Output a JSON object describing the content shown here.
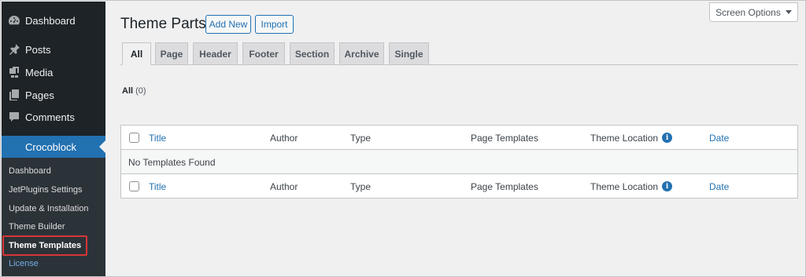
{
  "sidebar": {
    "menu": [
      {
        "label": "Dashboard",
        "icon": "dashboard-icon"
      },
      {
        "label": "Posts",
        "icon": "pin-icon"
      },
      {
        "label": "Media",
        "icon": "media-icon"
      },
      {
        "label": "Pages",
        "icon": "pages-icon"
      },
      {
        "label": "Comments",
        "icon": "comment-icon"
      },
      {
        "label": "Crocoblock",
        "icon": "crocoblock-icon"
      }
    ],
    "submenu": [
      {
        "label": "Dashboard"
      },
      {
        "label": "JetPlugins Settings"
      },
      {
        "label": "Update & Installation"
      },
      {
        "label": "Theme Builder"
      },
      {
        "label": "Theme Templates"
      },
      {
        "label": "License"
      }
    ]
  },
  "header": {
    "title": "Theme Parts",
    "add_new": "Add New",
    "import": "Import",
    "screen_options": "Screen Options"
  },
  "tabs": [
    {
      "label": "All",
      "active": true
    },
    {
      "label": "Page"
    },
    {
      "label": "Header"
    },
    {
      "label": "Footer"
    },
    {
      "label": "Section"
    },
    {
      "label": "Archive"
    },
    {
      "label": "Single"
    }
  ],
  "filter": {
    "label": "All",
    "count": "(0)"
  },
  "table": {
    "columns": [
      "Title",
      "Author",
      "Type",
      "Page Templates",
      "Theme Location",
      "Date"
    ],
    "empty_message": "No Templates Found",
    "info_icon": "i"
  },
  "colors": {
    "sidebar_bg": "#1d2327",
    "accent": "#2271b1",
    "highlight": "#d63638"
  }
}
